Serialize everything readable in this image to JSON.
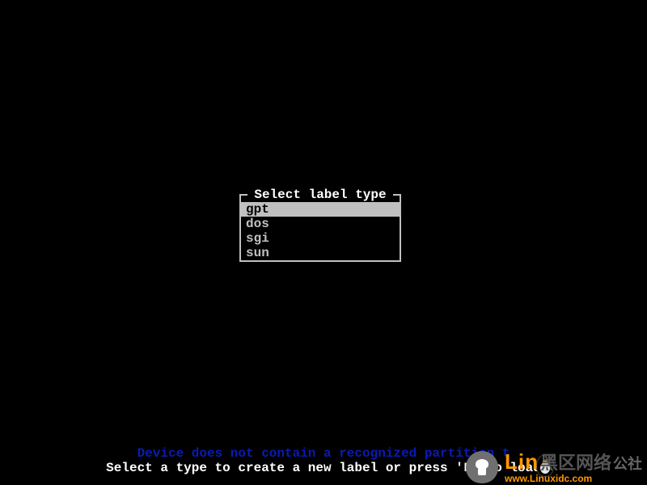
{
  "dialog": {
    "title": "Select label type",
    "options": [
      {
        "label": "gpt",
        "selected": true
      },
      {
        "label": "dos",
        "selected": false
      },
      {
        "label": "sgi",
        "selected": false
      },
      {
        "label": "sun",
        "selected": false
      }
    ]
  },
  "status": {
    "line1": "Device does not contain a recognized partition t",
    "line2": "Select a type to create a new label or press 'L' to load"
  },
  "watermark": {
    "cn": "黑区网络",
    "brand_prefix": "Lin",
    "brand_suffix": "公社",
    "url": "www.Linuxidc.com"
  }
}
